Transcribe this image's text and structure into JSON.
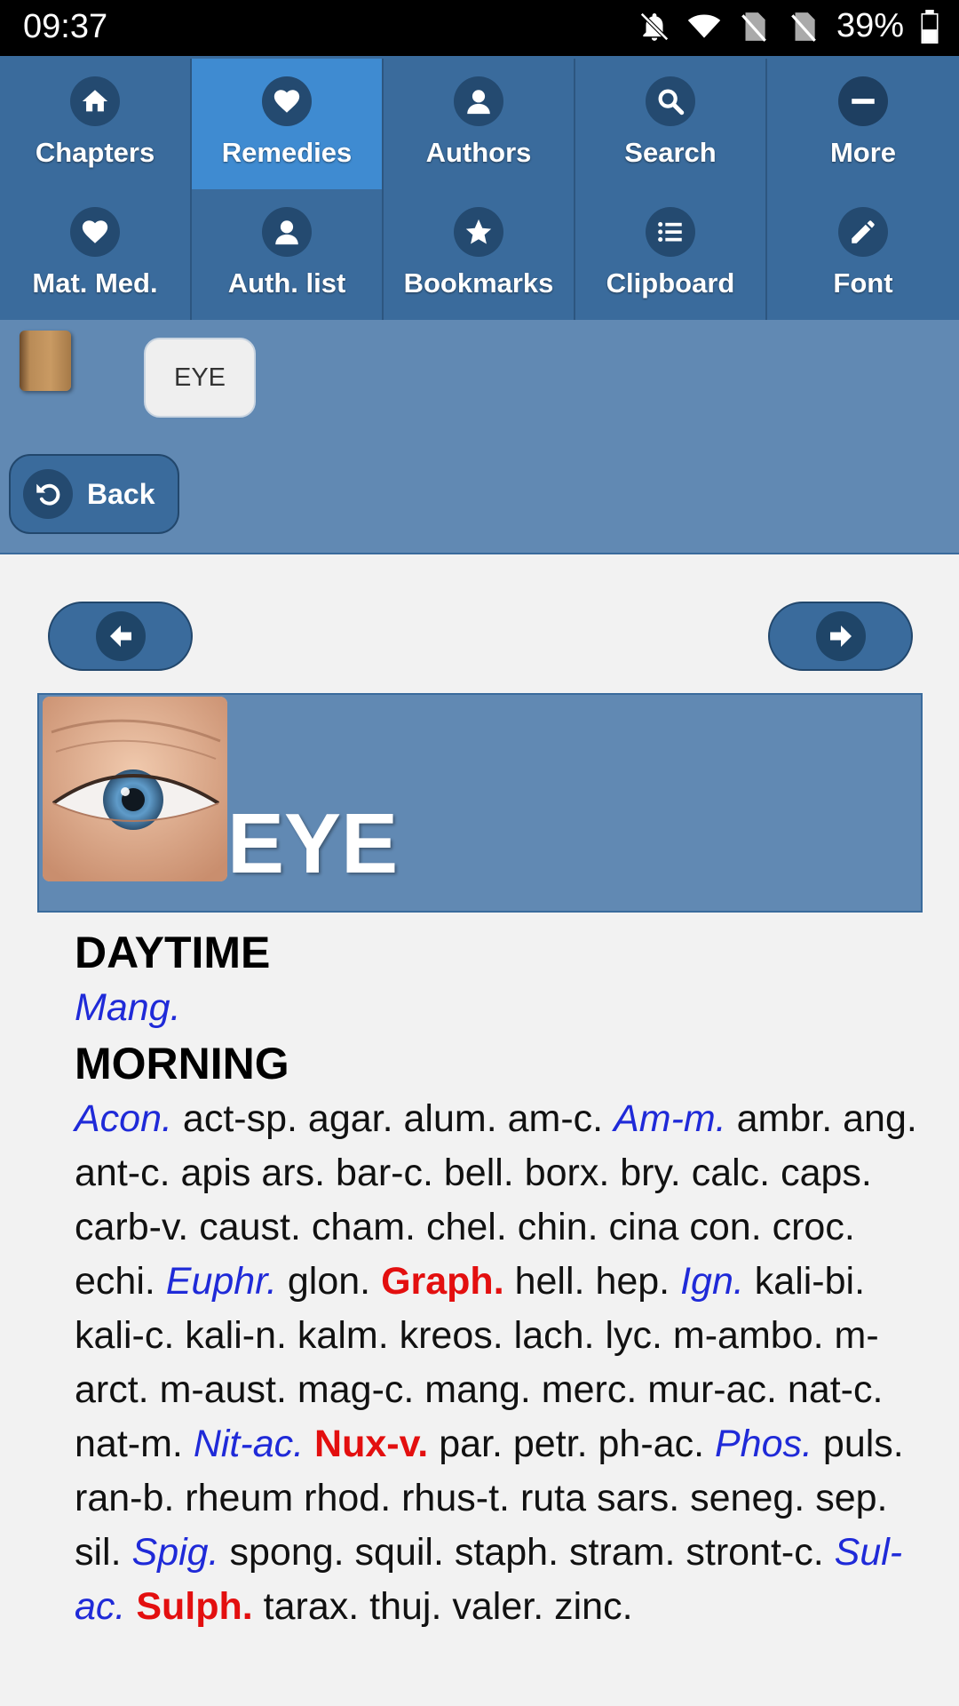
{
  "status_bar": {
    "time": "09:37",
    "battery": "39%"
  },
  "toolbar": {
    "items": [
      {
        "label": "Chapters",
        "icon": "home-icon",
        "active": false
      },
      {
        "label": "Remedies",
        "icon": "heart-icon",
        "active": true
      },
      {
        "label": "Authors",
        "icon": "person-icon",
        "active": false
      },
      {
        "label": "Search",
        "icon": "search-icon",
        "active": false
      },
      {
        "label": "More",
        "icon": "minus-icon",
        "active": false
      },
      {
        "label": "Mat. Med.",
        "icon": "heart-icon",
        "active": false
      },
      {
        "label": "Auth. list",
        "icon": "person-icon",
        "active": false
      },
      {
        "label": "Bookmarks",
        "icon": "star-icon",
        "active": false
      },
      {
        "label": "Clipboard",
        "icon": "list-icon",
        "active": false
      },
      {
        "label": "Font",
        "icon": "pencil-icon",
        "active": false
      }
    ]
  },
  "breadcrumb": {
    "chip": "EYE"
  },
  "back_label": "Back",
  "banner": {
    "title": "EYE"
  },
  "sections": [
    {
      "heading": "DAYTIME",
      "remedies": [
        {
          "t": "Mang.",
          "s": "italic"
        }
      ]
    },
    {
      "heading": "MORNING",
      "remedies": [
        {
          "t": "Acon.",
          "s": "italic"
        },
        {
          "t": "act-sp.",
          "s": "plain"
        },
        {
          "t": "agar.",
          "s": "plain"
        },
        {
          "t": "alum.",
          "s": "plain"
        },
        {
          "t": "am-c.",
          "s": "plain"
        },
        {
          "t": "Am-m.",
          "s": "italic"
        },
        {
          "t": "ambr.",
          "s": "plain"
        },
        {
          "t": "ang.",
          "s": "plain"
        },
        {
          "t": "ant-c.",
          "s": "plain"
        },
        {
          "t": "apis",
          "s": "plain"
        },
        {
          "t": "ars.",
          "s": "plain"
        },
        {
          "t": "bar-c.",
          "s": "plain"
        },
        {
          "t": "bell.",
          "s": "plain"
        },
        {
          "t": "borx.",
          "s": "plain"
        },
        {
          "t": "bry.",
          "s": "plain"
        },
        {
          "t": "calc.",
          "s": "plain"
        },
        {
          "t": "caps.",
          "s": "plain"
        },
        {
          "t": "carb-v.",
          "s": "plain"
        },
        {
          "t": "caust.",
          "s": "plain"
        },
        {
          "t": "cham.",
          "s": "plain"
        },
        {
          "t": "chel.",
          "s": "plain"
        },
        {
          "t": "chin.",
          "s": "plain"
        },
        {
          "t": "cina",
          "s": "plain"
        },
        {
          "t": "con.",
          "s": "plain"
        },
        {
          "t": "croc.",
          "s": "plain"
        },
        {
          "t": "echi.",
          "s": "plain"
        },
        {
          "t": "Euphr.",
          "s": "italic"
        },
        {
          "t": "glon.",
          "s": "plain"
        },
        {
          "t": "Graph.",
          "s": "bold"
        },
        {
          "t": "hell.",
          "s": "plain"
        },
        {
          "t": "hep.",
          "s": "plain"
        },
        {
          "t": "Ign.",
          "s": "italic"
        },
        {
          "t": "kali-bi.",
          "s": "plain"
        },
        {
          "t": "kali-c.",
          "s": "plain"
        },
        {
          "t": "kali-n.",
          "s": "plain"
        },
        {
          "t": "kalm.",
          "s": "plain"
        },
        {
          "t": "kreos.",
          "s": "plain"
        },
        {
          "t": "lach.",
          "s": "plain"
        },
        {
          "t": "lyc.",
          "s": "plain"
        },
        {
          "t": "m-ambo.",
          "s": "plain"
        },
        {
          "t": "m-arct.",
          "s": "plain"
        },
        {
          "t": "m-aust.",
          "s": "plain"
        },
        {
          "t": "mag-c.",
          "s": "plain"
        },
        {
          "t": "mang.",
          "s": "plain"
        },
        {
          "t": "merc.",
          "s": "plain"
        },
        {
          "t": "mur-ac.",
          "s": "plain"
        },
        {
          "t": "nat-c.",
          "s": "plain"
        },
        {
          "t": "nat-m.",
          "s": "plain"
        },
        {
          "t": "Nit-ac.",
          "s": "italic"
        },
        {
          "t": "Nux-v.",
          "s": "bold"
        },
        {
          "t": "par.",
          "s": "plain"
        },
        {
          "t": "petr.",
          "s": "plain"
        },
        {
          "t": "ph-ac.",
          "s": "plain"
        },
        {
          "t": "Phos.",
          "s": "italic"
        },
        {
          "t": "puls.",
          "s": "plain"
        },
        {
          "t": "ran-b.",
          "s": "plain"
        },
        {
          "t": "rheum",
          "s": "plain"
        },
        {
          "t": "rhod.",
          "s": "plain"
        },
        {
          "t": "rhus-t.",
          "s": "plain"
        },
        {
          "t": "ruta",
          "s": "plain"
        },
        {
          "t": "sars.",
          "s": "plain"
        },
        {
          "t": "seneg.",
          "s": "plain"
        },
        {
          "t": "sep.",
          "s": "plain"
        },
        {
          "t": "sil.",
          "s": "plain"
        },
        {
          "t": "Spig.",
          "s": "italic"
        },
        {
          "t": "spong.",
          "s": "plain"
        },
        {
          "t": "squil.",
          "s": "plain"
        },
        {
          "t": "staph.",
          "s": "plain"
        },
        {
          "t": "stram.",
          "s": "plain"
        },
        {
          "t": "stront-c.",
          "s": "plain"
        },
        {
          "t": "Sul-ac.",
          "s": "italic"
        },
        {
          "t": "Sulph.",
          "s": "bold"
        },
        {
          "t": "tarax.",
          "s": "plain"
        },
        {
          "t": "thuj.",
          "s": "plain"
        },
        {
          "t": "valer.",
          "s": "plain"
        },
        {
          "t": "zinc.",
          "s": "plain"
        }
      ]
    }
  ],
  "colors": {
    "toolbar": "#3a6b9c",
    "active_tab": "#3f8bd1",
    "panel": "#6189b3",
    "italic_remedy": "#1f2ad8",
    "bold_remedy": "#e30f0f"
  }
}
